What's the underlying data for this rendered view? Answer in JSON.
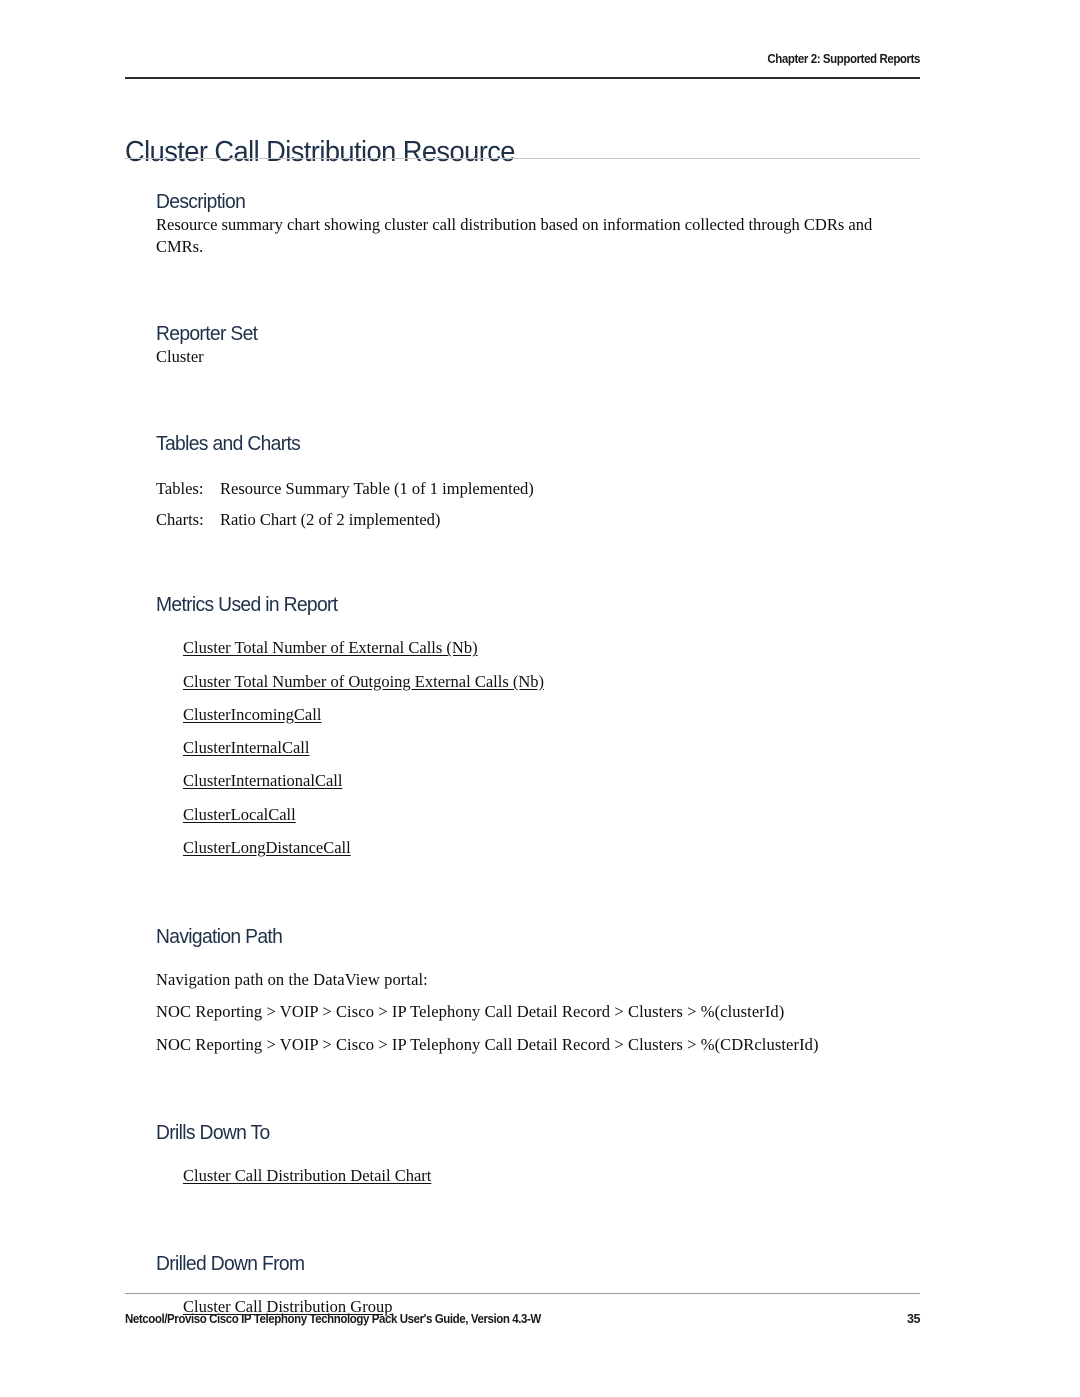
{
  "header": {
    "running_head": "Chapter 2: Supported Reports"
  },
  "title": "Cluster Call Distribution Resource",
  "sections": {
    "description": {
      "heading": "Description",
      "paragraph": "Resource summary chart showing cluster call distribution based on information collected through CDRs and CMRs."
    },
    "reporter_set": {
      "heading": "Reporter Set",
      "value": "Cluster"
    },
    "tables_and_charts": {
      "heading": "Tables and Charts",
      "rows": [
        {
          "key": "Tables:",
          "value": "Resource Summary Table (1 of 1 implemented)"
        },
        {
          "key": "Charts:",
          "value": "Ratio Chart (2 of 2 implemented)"
        }
      ]
    },
    "metrics_used": {
      "heading": "Metrics Used in Report",
      "links": [
        "Cluster Total Number of External Calls (Nb)",
        "Cluster Total Number of Outgoing External Calls (Nb)",
        "ClusterIncomingCall",
        "ClusterInternalCall",
        "ClusterInternationalCall",
        "ClusterLocalCall",
        "ClusterLongDistanceCall "
      ]
    },
    "navigation_path": {
      "heading": "Navigation Path",
      "intro": "Navigation path on the DataView portal:",
      "paths": [
        "NOC Reporting >  VOIP >  Cisco >  IP Telephony Call Detail Record >  Clusters >  %(clusterId)",
        "NOC Reporting >  VOIP >  Cisco >  IP Telephony Call Detail Record >  Clusters >  %(CDRclusterId)"
      ]
    },
    "drills_down_to": {
      "heading": "Drills Down To",
      "links": [
        "Cluster Call Distribution Detail Chart "
      ]
    },
    "drilled_down_from": {
      "heading": "Drilled Down From",
      "links": [
        "Cluster Call Distribution Group"
      ]
    }
  },
  "footer": {
    "text": "Netcool/Proviso Cisco IP Telephony Technology Pack User's Guide, Version 4.3-W",
    "page_number": "35"
  },
  "colors": {
    "heading_navy": "#1f3049",
    "body_text": "#0d0d0d",
    "rule_dark": "#2b2b2b",
    "rule_light": "#c8c8c8"
  }
}
